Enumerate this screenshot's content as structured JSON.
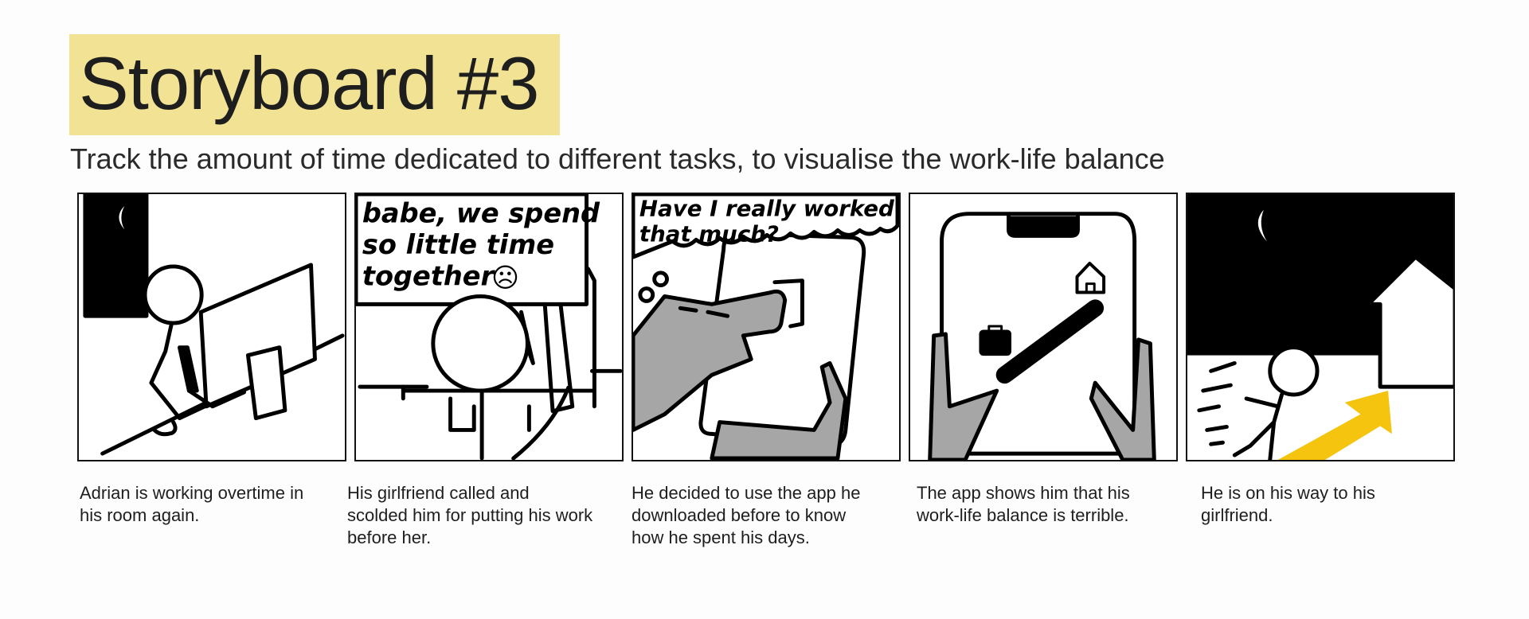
{
  "title": "Storyboard #3",
  "subtitle": "Track the amount of time dedicated to different tasks, to visualise the work-life balance",
  "colors": {
    "title_highlight": "#f2e394",
    "ink": "#000000",
    "hand_gray": "#a6a6a6",
    "arrow_yellow": "#f5c40f"
  },
  "panels": [
    {
      "caption": "Adrian is working overtime in his room again."
    },
    {
      "speech_line1": "babe, we spend",
      "speech_line2": "so little time",
      "speech_line3": "together",
      "caption": "His girlfriend called and scolded him for putting his work before her."
    },
    {
      "thought_line1": "Have I really worked",
      "thought_line2": "that much?",
      "caption": "He decided to use the app he downloaded before to know how he spent his days."
    },
    {
      "caption": "The app shows him that his work-life balance is terrible."
    },
    {
      "caption": "He is on his way to his girlfriend."
    }
  ]
}
